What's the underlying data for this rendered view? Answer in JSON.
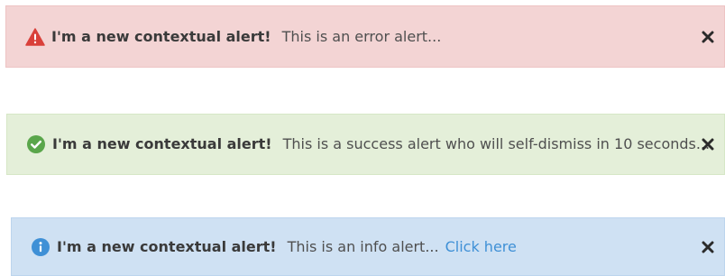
{
  "alerts": [
    {
      "type": "error",
      "icon": "warning-triangle-icon",
      "title": "I'm a new contextual alert!",
      "message": "This is an error alert...",
      "close_icon": "close-icon",
      "colors": {
        "background": "#f3d4d4",
        "icon": "#d9403a"
      }
    },
    {
      "type": "success",
      "icon": "check-circle-icon",
      "title": "I'm a new contextual alert!",
      "message": "This is a success alert who will self-dismiss in 10 seconds...",
      "close_icon": "close-icon",
      "colors": {
        "background": "#e4efd9",
        "icon": "#5aa64b"
      }
    },
    {
      "type": "info",
      "icon": "info-circle-icon",
      "title": "I'm a new contextual alert!",
      "message": "This is an info alert...",
      "link": "Click here",
      "close_icon": "close-icon",
      "colors": {
        "background": "#cfe1f3",
        "icon": "#3f90d6",
        "link": "#3f90d6"
      }
    }
  ]
}
